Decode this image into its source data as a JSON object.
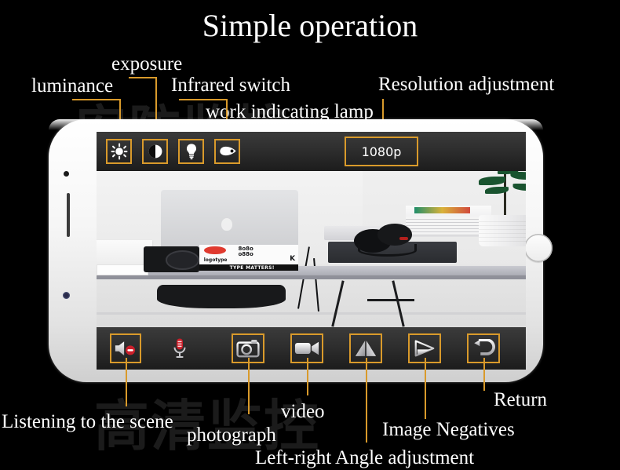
{
  "page": {
    "title": "Simple operation",
    "background_color": "#000000",
    "accent_color": "#d99a2b",
    "watermark_1": "安防监控",
    "watermark_2": "高清监控"
  },
  "device": {
    "type": "smartphone",
    "orientation": "landscape",
    "body_color": "#ffffff"
  },
  "screen": {
    "top_toolbar": {
      "buttons": [
        {
          "id": "luminance",
          "icon": "sun-icon",
          "bordered": true
        },
        {
          "id": "exposure",
          "icon": "contrast-icon",
          "bordered": true
        },
        {
          "id": "work-lamp",
          "icon": "lightbulb-icon",
          "bordered": true
        },
        {
          "id": "infrared-switch",
          "icon": "infrared-icon",
          "bordered": true
        }
      ],
      "resolution_badge": {
        "value": "1080p",
        "border_color": "#d99a2b"
      }
    },
    "bottom_toolbar": {
      "buttons": [
        {
          "id": "listen",
          "icon": "speaker-mute-icon",
          "bordered": true,
          "badge_color": "#cc1f2a"
        },
        {
          "id": "microphone",
          "icon": "microphone-icon",
          "bordered": false,
          "badge_color": "#cc1f2a"
        },
        {
          "id": "photograph",
          "icon": "camera-icon",
          "bordered": true
        },
        {
          "id": "video",
          "icon": "video-camera-icon",
          "bordered": true
        },
        {
          "id": "negatives",
          "icon": "mirror-triangle-icon",
          "bordered": true
        },
        {
          "id": "angle",
          "icon": "flip-triangle-icon",
          "bordered": true
        },
        {
          "id": "return",
          "icon": "return-arrow-icon",
          "bordered": true
        }
      ]
    },
    "preview": {
      "description": "Desk scene with laptop, camera, books, headphones and plant",
      "book_title": "logotype",
      "book_subtitle": "TYPE MATTERS!",
      "book_letter": "K"
    }
  },
  "callouts": {
    "top": [
      {
        "id": "luminance",
        "label": "luminance"
      },
      {
        "id": "exposure",
        "label": "exposure"
      },
      {
        "id": "infrared",
        "label": "Infrared switch"
      },
      {
        "id": "work-lamp",
        "label": "work indicating lamp"
      },
      {
        "id": "resolution",
        "label": "Resolution adjustment"
      }
    ],
    "bottom": [
      {
        "id": "listen",
        "label": "Listening to the scene"
      },
      {
        "id": "photograph",
        "label": "photograph"
      },
      {
        "id": "video",
        "label": "video"
      },
      {
        "id": "angle",
        "label": "Left-right Angle adjustment"
      },
      {
        "id": "negatives",
        "label": "Image Negatives"
      },
      {
        "id": "return",
        "label": "Return"
      }
    ]
  }
}
